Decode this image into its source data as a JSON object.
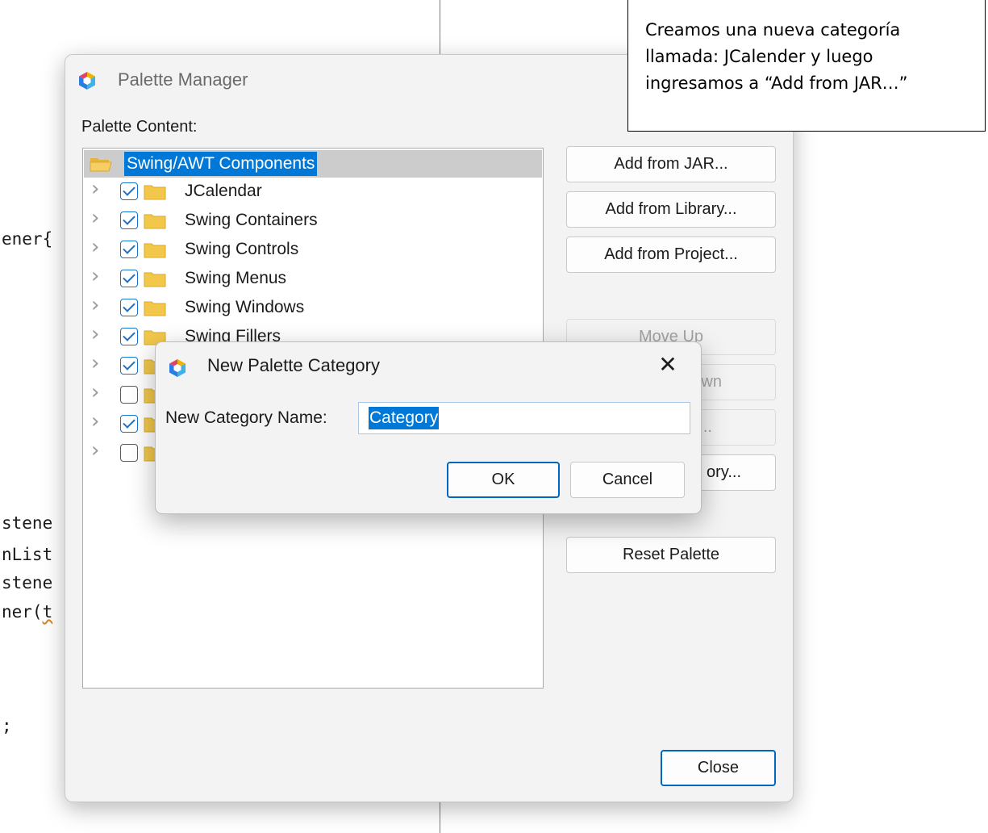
{
  "background_code": {
    "lines": [
      "ener{",
      "stene",
      "nList",
      "stene",
      "ner(",
      "t",
      ";"
    ]
  },
  "palette_manager": {
    "title": "Palette Manager",
    "content_label": "Palette Content:",
    "tree": {
      "root_label": "Swing/AWT Components",
      "items": [
        {
          "label": "JCalendar",
          "checked": true
        },
        {
          "label": "Swing Containers",
          "checked": true
        },
        {
          "label": "Swing Controls",
          "checked": true
        },
        {
          "label": "Swing Menus",
          "checked": true
        },
        {
          "label": "Swing Windows",
          "checked": true
        },
        {
          "label": "Swing Fillers",
          "checked": true
        },
        {
          "label": "",
          "checked": true
        },
        {
          "label": "",
          "checked": false
        },
        {
          "label": "",
          "checked": true
        },
        {
          "label": "",
          "checked": false
        }
      ]
    },
    "buttons": {
      "add_from_jar": "Add from JAR...",
      "add_from_library": "Add from Library...",
      "add_from_project": "Add from Project...",
      "move_up": "Move Up",
      "move_down": "wn",
      "remove": "..",
      "new_category": "ory...",
      "reset_palette": "Reset Palette",
      "close": "Close"
    }
  },
  "annotation": {
    "text": "Creamos una nueva categoría llamada: JCalender y luego ingresamos a “Add from JAR…”"
  },
  "new_category_dialog": {
    "title": "New Palette Category",
    "close_glyph": "✕",
    "name_label": "New Category Name:",
    "name_value": "Category",
    "ok_label": "OK",
    "cancel_label": "Cancel"
  },
  "colors": {
    "selection": "#0078d7",
    "focus_border": "#0067c0",
    "checkbox": "#1a73c8",
    "folder": "#f2c84b"
  }
}
